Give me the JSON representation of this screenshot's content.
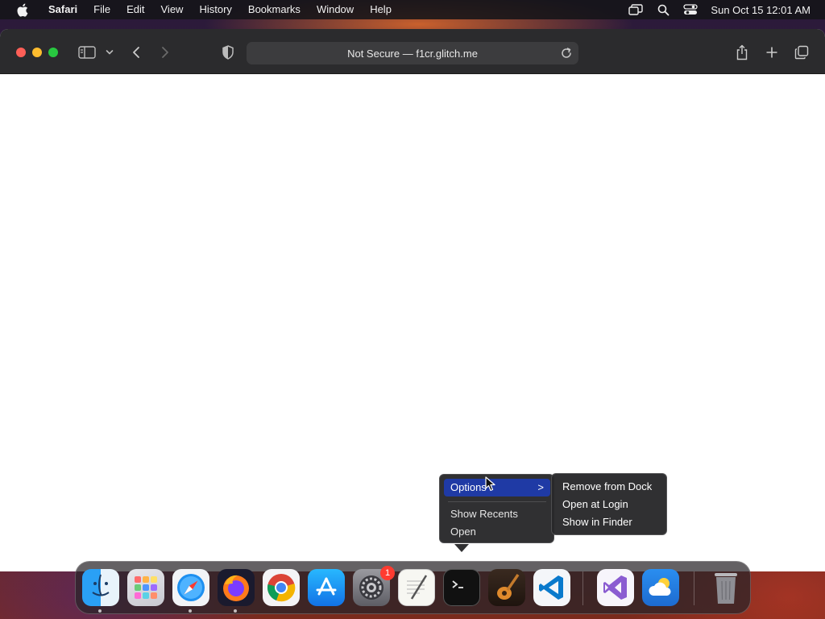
{
  "menubar": {
    "app_name": "Safari",
    "items": [
      "File",
      "Edit",
      "View",
      "History",
      "Bookmarks",
      "Window",
      "Help"
    ],
    "status_icons": [
      "screen-mirroring-icon",
      "spotlight-search-icon",
      "control-center-icon"
    ],
    "clock": "Sun Oct 15  12:01 AM"
  },
  "browser": {
    "address_text": "Not Secure — f1cr.glitch.me",
    "toolbar_icons": [
      "sidebar-icon",
      "chevron-down-icon",
      "back-icon",
      "forward-icon",
      "privacy-shield-icon",
      "reload-icon",
      "share-icon",
      "new-tab-icon",
      "tab-overview-icon"
    ]
  },
  "context_menu": {
    "items": [
      {
        "label": "Options",
        "highlighted": true,
        "has_submenu": true
      },
      {
        "label": "Show Recents"
      },
      {
        "label": "Open"
      }
    ],
    "submenu_arrow": ">"
  },
  "submenu": {
    "items": [
      "Remove from Dock",
      "Open at Login",
      "Show in Finder"
    ]
  },
  "dock": {
    "apps": [
      "Finder",
      "Launchpad",
      "Safari",
      "Firefox",
      "Google Chrome",
      "App Store",
      "System Settings",
      "TextEdit",
      "Terminal",
      "GarageBand",
      "Visual Studio Code",
      "Visual Studio",
      "Weather",
      "Trash"
    ],
    "system_settings_badge": "1"
  },
  "colors": {
    "menu_highlight": "#1f3aa5",
    "close": "#ff5f57",
    "minimize": "#febc2e",
    "maximize": "#28c840"
  }
}
